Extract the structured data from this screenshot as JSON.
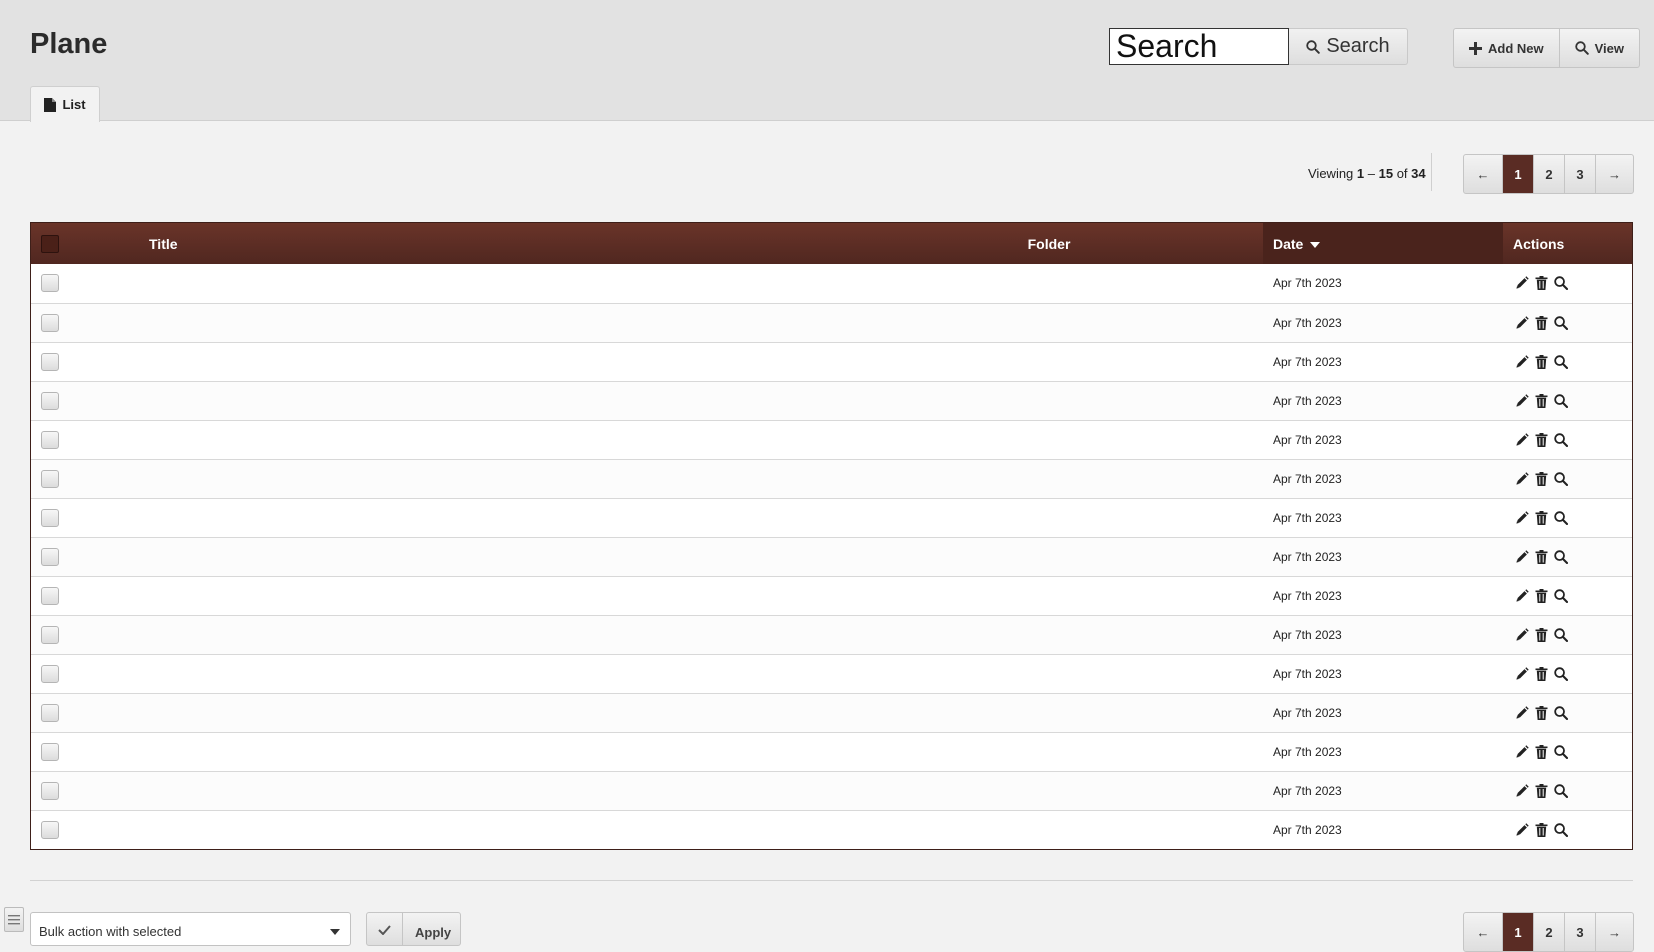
{
  "header": {
    "title": "Plane",
    "search_value": "Search",
    "search_button": "Search",
    "add_new": "Add New",
    "view": "View"
  },
  "tabs": [
    {
      "label": "List"
    }
  ],
  "pagination": {
    "viewing_prefix": "Viewing ",
    "range_start": "1",
    "range_sep": " – ",
    "range_end": "15",
    "of_label": " of ",
    "total": "34",
    "prev": "←",
    "next": "→",
    "pages": [
      "1",
      "2",
      "3"
    ],
    "current_page": "1"
  },
  "table": {
    "columns": {
      "title": "Title",
      "folder": "Folder",
      "date": "Date",
      "actions": "Actions"
    },
    "sort_column": "date",
    "rows": [
      {
        "title": "",
        "folder": "",
        "date": "Apr 7th 2023"
      },
      {
        "title": "",
        "folder": "",
        "date": "Apr 7th 2023"
      },
      {
        "title": "",
        "folder": "",
        "date": "Apr 7th 2023"
      },
      {
        "title": "",
        "folder": "",
        "date": "Apr 7th 2023"
      },
      {
        "title": "",
        "folder": "",
        "date": "Apr 7th 2023"
      },
      {
        "title": "",
        "folder": "",
        "date": "Apr 7th 2023"
      },
      {
        "title": "",
        "folder": "",
        "date": "Apr 7th 2023"
      },
      {
        "title": "",
        "folder": "",
        "date": "Apr 7th 2023"
      },
      {
        "title": "",
        "folder": "",
        "date": "Apr 7th 2023"
      },
      {
        "title": "",
        "folder": "",
        "date": "Apr 7th 2023"
      },
      {
        "title": "",
        "folder": "",
        "date": "Apr 7th 2023"
      },
      {
        "title": "",
        "folder": "",
        "date": "Apr 7th 2023"
      },
      {
        "title": "",
        "folder": "",
        "date": "Apr 7th 2023"
      },
      {
        "title": "",
        "folder": "",
        "date": "Apr 7th 2023"
      },
      {
        "title": "",
        "folder": "",
        "date": "Apr 7th 2023"
      }
    ],
    "row_actions": [
      "pencil-icon",
      "trash-icon",
      "magnifier-icon"
    ]
  },
  "footer": {
    "bulk_action": "Bulk action with selected",
    "apply": "Apply"
  },
  "colors": {
    "table_header": "#5a2c24",
    "active_page": "#5a2c24",
    "header_bg": "#e2e2e2",
    "page_bg": "#f2f2f2"
  }
}
